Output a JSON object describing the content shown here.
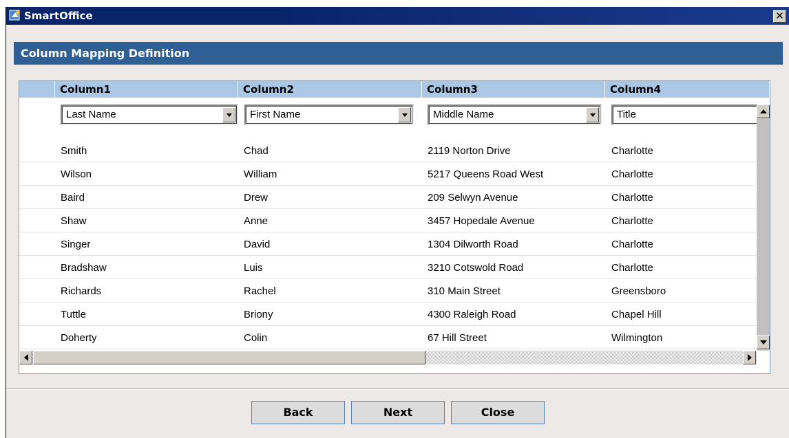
{
  "window": {
    "title": "SmartOffice",
    "close_glyph": "✕"
  },
  "section": {
    "heading": "Column Mapping Definition"
  },
  "grid": {
    "columns": [
      "Column1",
      "Column2",
      "Column3",
      "Column4"
    ],
    "mappings": [
      "Last Name",
      "First Name",
      "Middle Name",
      "Title"
    ],
    "rows": [
      [
        "Smith",
        "Chad",
        "2119 Norton Drive",
        "Charlotte"
      ],
      [
        "Wilson",
        "William",
        "5217 Queens Road West",
        "Charlotte"
      ],
      [
        "Baird",
        "Drew",
        "209 Selwyn Avenue",
        "Charlotte"
      ],
      [
        "Shaw",
        "Anne",
        "3457 Hopedale Avenue",
        "Charlotte"
      ],
      [
        "Singer",
        "David",
        "1304 Dilworth Road",
        "Charlotte"
      ],
      [
        "Bradshaw",
        "Luis",
        "3210 Cotswold Road",
        "Charlotte"
      ],
      [
        "Richards",
        "Rachel",
        "310 Main Street",
        "Greensboro"
      ],
      [
        "Tuttle",
        "Briony",
        "4300 Raleigh Road",
        "Chapel Hill"
      ],
      [
        "Doherty",
        "Colin",
        "67 Hill Street",
        "Wilmington"
      ]
    ]
  },
  "buttons": {
    "back": "Back",
    "next": "Next",
    "close": "Close"
  },
  "colors": {
    "title_bar": "#0a246a",
    "section_bar": "#2e6096",
    "column_header": "#aac8e6"
  },
  "icons": {
    "app": "smartoffice-app-icon",
    "close": "close-icon"
  }
}
